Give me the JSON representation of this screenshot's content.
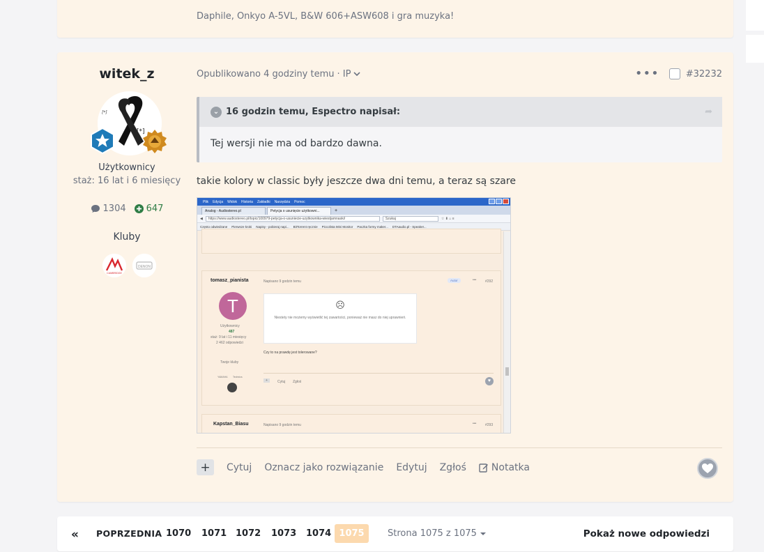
{
  "previous_post": {
    "signature": "Daphile, Onkyo A-5VL, B&W 606+ASW608 i gra muzyka!"
  },
  "post": {
    "author": {
      "name": "witek_z",
      "group": "Użytkownicy",
      "tenure": "staż: 16 lat i 6 miesięcy",
      "posts_count": "1304",
      "reputation": "647",
      "clubs_label": "Kluby",
      "club_logos": [
        "CAMBRIDGE",
        "DENON"
      ]
    },
    "meta": {
      "published": "Opublikowano 4 godziny temu",
      "ip_label": "· IP",
      "post_number": "#32232"
    },
    "quote": {
      "header": "16 godzin temu, Espectro napisał:",
      "body": "Tej wersji nie ma od bardzo dawna."
    },
    "text": "takie kolory w classic były jeszcze dwa dni temu, a teraz są szare",
    "actions": {
      "quote": "Cytuj",
      "mark_solution": "Oznacz jako rozwiązanie",
      "edit": "Edytuj",
      "report": "Zgłoś",
      "note": "Notatka"
    }
  },
  "screenshot": {
    "menu": [
      "Plik",
      "Edycja",
      "Widok",
      "Historia",
      "Zakładki",
      "Narzędzia",
      "Pomoc"
    ],
    "tabs": [
      "Analog - Audiostereo.pl",
      "Petycja o usunięcie użytkowni..."
    ],
    "url": "https://www.audiostereo.pl/topic/100979-petycja-o-usuniecie-uzytkownika-wiestjamnaski/",
    "search_placeholder": "Szukaj",
    "bookmarks": [
      "Często odwiedzane",
      "Pierwsze kroki",
      "Napisy - pobieraj napi...",
      "BitTorrent ręcznie",
      "Piccolista Mini Monitor",
      "Paczka formy maker...",
      "DTAaudio.pl - Speaker..."
    ],
    "post1": {
      "author": "tomasz_pianista",
      "time": "Napisano 9 godzin temu",
      "badge": "Autor",
      "number": "#292",
      "avatar_letter": "T",
      "group": "Użytkownicy",
      "rep": "487",
      "tenure": "staż: 9 lat i 11 miesięcy",
      "posts": "2 462 odpowiedzi",
      "clubs": "Twoje kluby",
      "club_logos": [
        "YAMAHA",
        "Technics"
      ],
      "error_icon": "☹",
      "error_text": "Niestety nie możemy wyświetlić tej zawartości, ponieważ nie masz do niej uprawnień.",
      "text": "Czy to na prawdę jest tolerowane?",
      "quote_btn": "Cytuj",
      "report_btn": "Zgłoś"
    },
    "post2": {
      "author": "Kapstan_Biasu",
      "time": "Napisano 9 godzin temu",
      "number": "#293"
    }
  },
  "pagination": {
    "prev_label": "POPRZEDNIA",
    "pages": [
      "1070",
      "1071",
      "1072",
      "1073",
      "1074"
    ],
    "current": "1075",
    "jump_label": "Strona 1075 z 1075",
    "new_replies": "Pokaż nowe odpowiedzi"
  },
  "colors": {
    "card_bg": "#fdf4e8",
    "accent": "#fcd9ae",
    "green": "#2f7d46"
  }
}
